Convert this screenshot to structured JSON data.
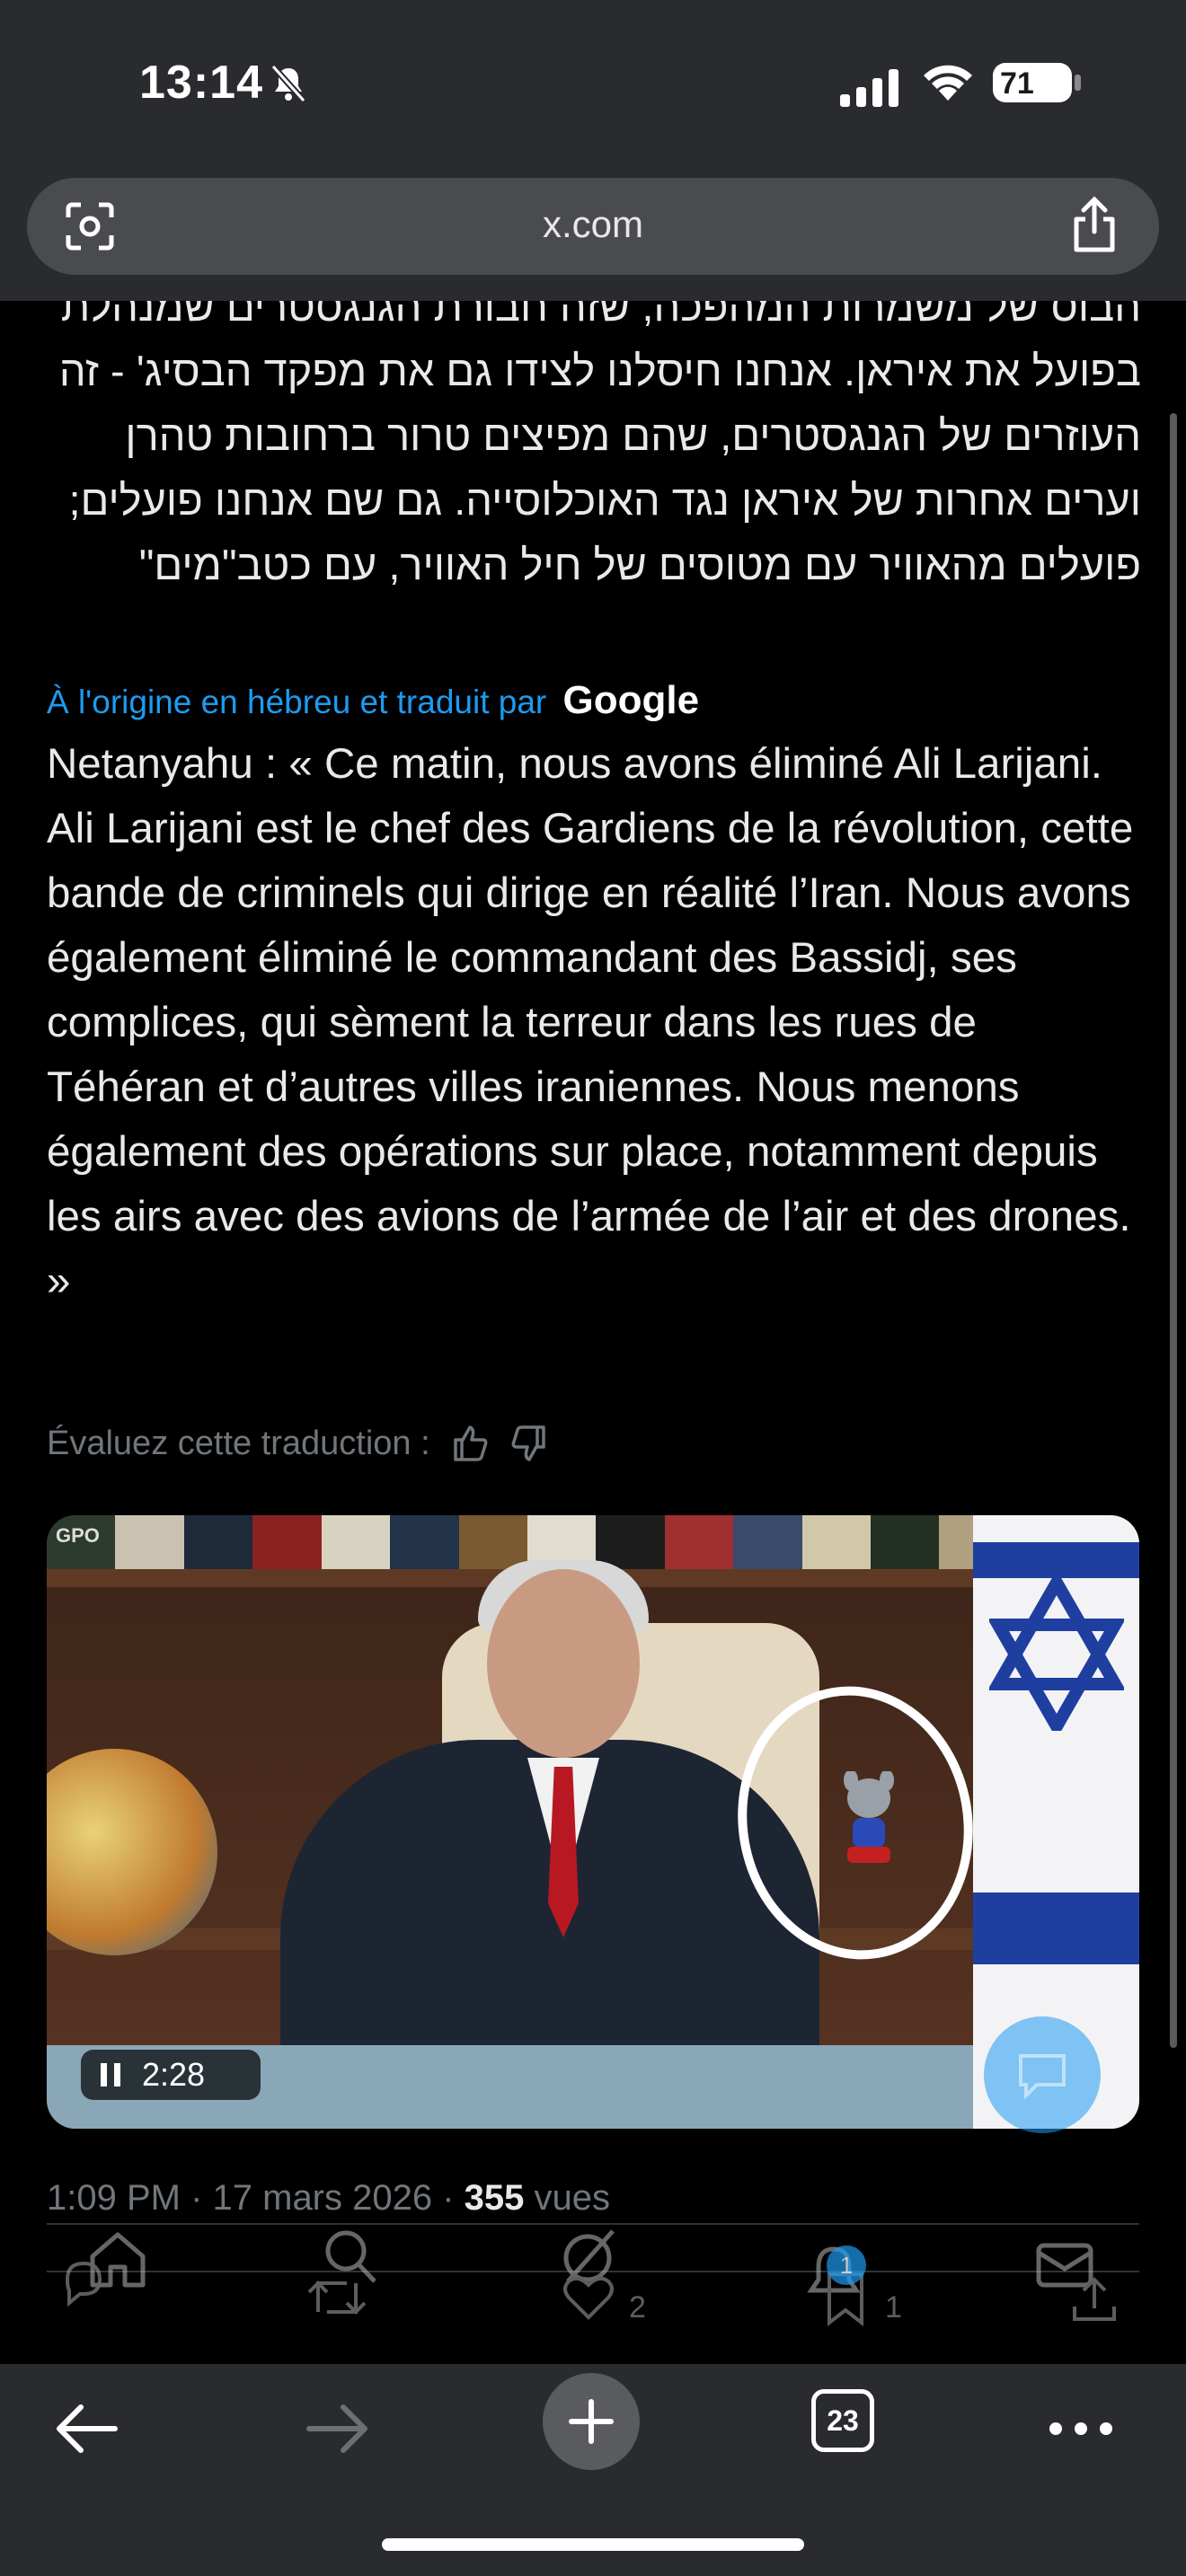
{
  "status_bar": {
    "time": "13:14",
    "battery": "71",
    "battery_level": 0.71
  },
  "browser": {
    "url": "x.com",
    "tab_count": "23"
  },
  "post": {
    "hebrew_text": "הבוס של משמרות המהפכה, שזה חבורת הגנגסטרים שמנהלת בפועל את איראן. אנחנו חיסלנו לצידו גם את מפקד הבסיג' - זה העוזרים של הגנגסטרים, שהם מפיצים טרור ברחובות טהרן וערים אחרות של איראן נגד האוכלוסייה. גם שם אנחנו פועלים; פועלים מהאוויר עם מטוסים של חיל האוויר, עם כטב\"מים\"",
    "translated_by": "À l'origine en hébreu et traduit par",
    "translator": "Google",
    "french_text": "Netanyahu : « Ce matin, nous avons éliminé Ali Larijani. Ali Larijani est le chef des Gardiens de la révolution, cette bande de criminels qui dirige en réalité l’Iran. Nous avons également éliminé le commandant des Bassidj, ses complices, qui sèment la terreur dans les rues de Téhéran et d’autres villes iraniennes. Nous menons également des opérations sur place, notamment depuis les airs avec des avions de l’armée de l’air et des drones. »",
    "rate_label": "Évaluez cette traduction :",
    "video": {
      "watermark": "GPO",
      "duration": "2:28"
    },
    "timestamp": "1:09 PM · 17 mars 2026 · ",
    "views_count": "355",
    "views_label": " vues",
    "likes": "2",
    "bookmarks": "1",
    "notification_badge": "1"
  }
}
